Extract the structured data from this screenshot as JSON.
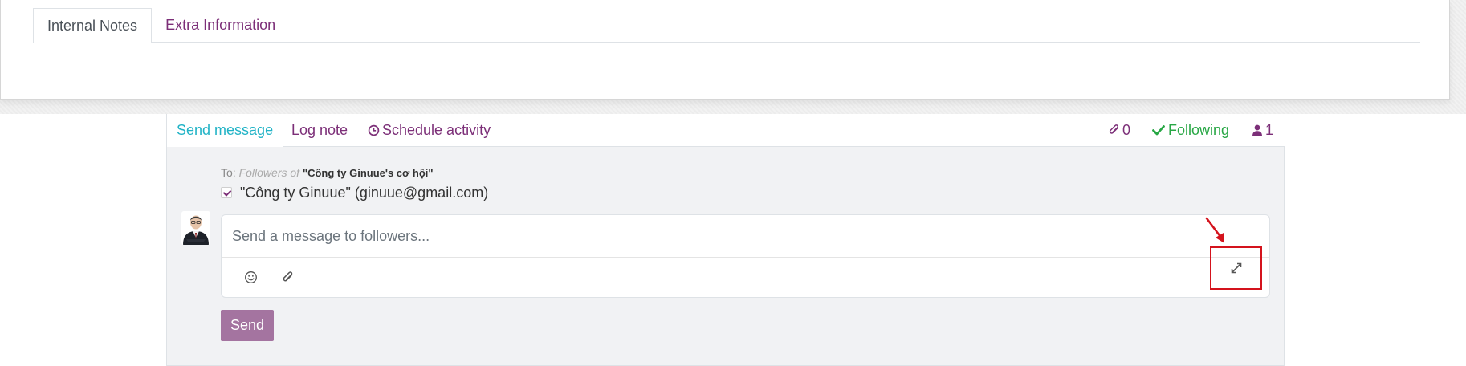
{
  "notebook": {
    "tabs": [
      {
        "label": "Internal Notes",
        "active": true
      },
      {
        "label": "Extra Information",
        "active": false
      }
    ]
  },
  "chatter": {
    "send_message": "Send message",
    "log_note": "Log note",
    "schedule_activity": "Schedule activity",
    "attachments_count": "0",
    "following": "Following",
    "followers_count": "1"
  },
  "composer": {
    "to_label": "To:",
    "to_followers": "Followers of",
    "to_record": "\"Công ty Ginuue's cơ hội\"",
    "recipient": "\"Công ty Ginuue\" (ginuue@gmail.com)",
    "recipient_checked": true,
    "placeholder": "Send a message to followers...",
    "send_label": "Send"
  },
  "icons": {
    "attachment": "paperclip-icon",
    "following": "check-icon",
    "followers": "user-icon",
    "schedule": "clock-icon",
    "emoji": "smiley-icon",
    "attach": "paperclip-icon",
    "expand": "expand-icon"
  },
  "colors": {
    "brand": "#7c2f78",
    "active_tab": "#21b3c6",
    "following": "#28a745",
    "send_button": "#a474a0",
    "highlight": "#d4131d"
  }
}
